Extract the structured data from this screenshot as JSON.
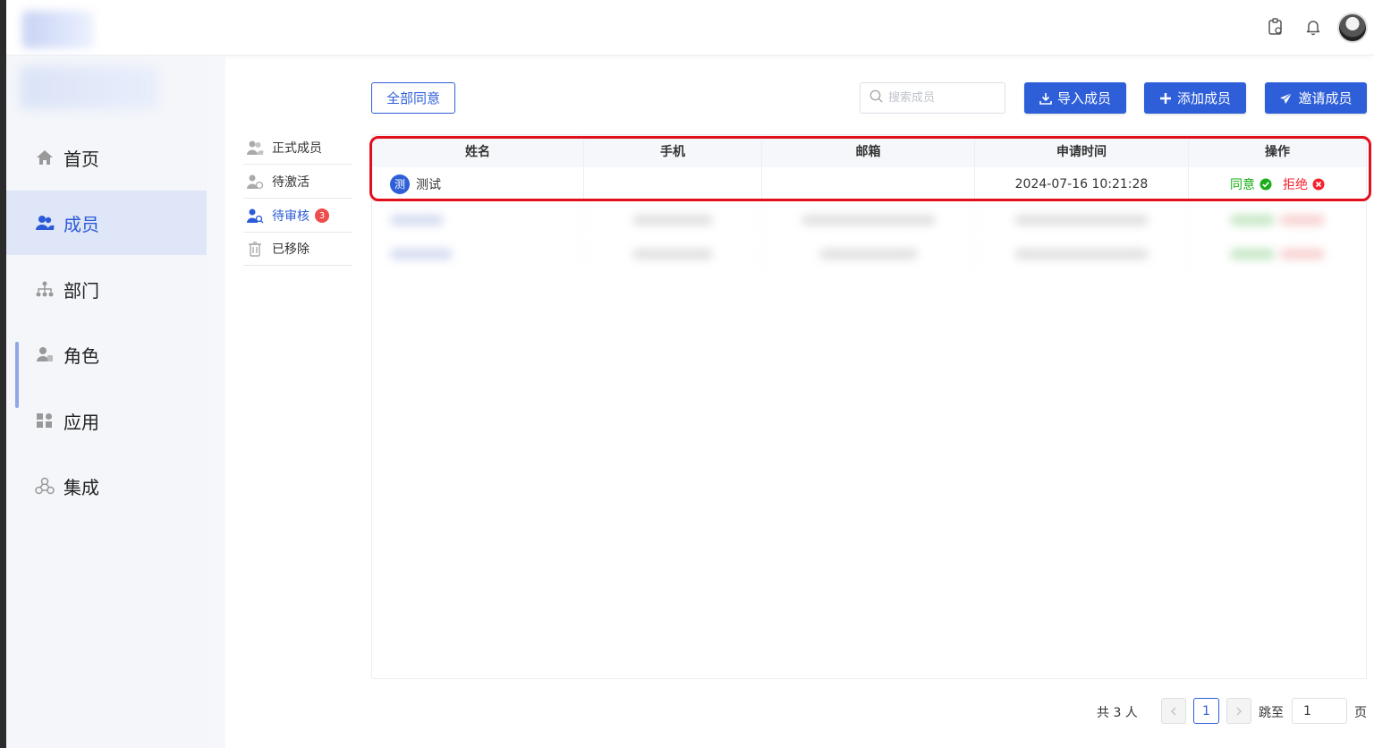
{
  "sidebar": {
    "items": [
      {
        "label": "首页",
        "icon": "home-icon"
      },
      {
        "label": "成员",
        "icon": "users-icon",
        "active": true
      },
      {
        "label": "部门",
        "icon": "org-tree-icon"
      },
      {
        "label": "角色",
        "icon": "role-icon"
      },
      {
        "label": "应用",
        "icon": "apps-icon"
      },
      {
        "label": "集成",
        "icon": "integration-icon"
      }
    ]
  },
  "submenu": {
    "items": [
      {
        "label": "正式成员"
      },
      {
        "label": "待激活"
      },
      {
        "label": "待审核",
        "badge": "3",
        "active": true
      },
      {
        "label": "已移除"
      }
    ]
  },
  "toolbar": {
    "approve_all_label": "全部同意",
    "search_placeholder": "搜索成员",
    "import_label": "导入成员",
    "add_label": "添加成员",
    "invite_label": "邀请成员"
  },
  "table": {
    "headers": [
      "姓名",
      "手机",
      "邮箱",
      "申请时间",
      "操作"
    ],
    "rows": [
      {
        "avatar_char": "测",
        "name": "测试",
        "phone": "",
        "email": "",
        "time": "2024-07-16 10:21:28",
        "agree": "同意",
        "reject": "拒绝"
      }
    ]
  },
  "pagination": {
    "total": "共 3 人",
    "page": "1",
    "jump_label": "跳至",
    "jump_value": "1",
    "page_suffix": "页"
  },
  "colors": {
    "primary": "#2f5fd8",
    "agree": "#1aad19",
    "reject": "#f5222d",
    "highlight": "#e0101c"
  }
}
